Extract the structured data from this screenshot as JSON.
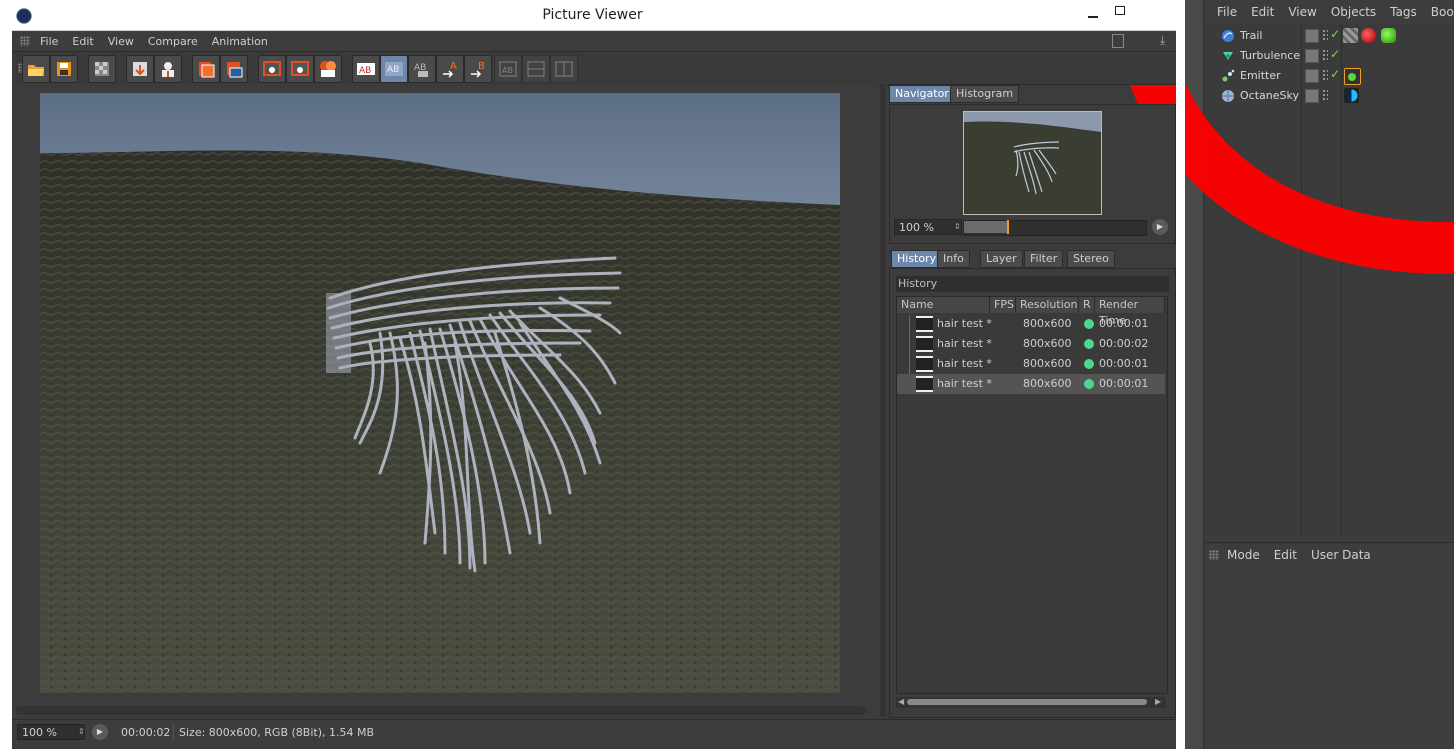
{
  "window": {
    "title": "Picture Viewer",
    "menu": [
      "File",
      "Edit",
      "View",
      "Compare",
      "Animation"
    ]
  },
  "toolbar": {
    "icons": [
      "open-icon",
      "save-icon",
      "transparency-icon",
      "render-queue-icon",
      "render-user-icon",
      "render-region-icon",
      "render-view-icon",
      "view-single-icon",
      "view-region-icon",
      "view-all-icon",
      "ab-compare-icon",
      "ab-split-icon",
      "ab-toggle-icon",
      "set-a-icon",
      "set-b-icon",
      "layout-1-icon",
      "layout-2-icon",
      "layout-3-icon"
    ]
  },
  "navigator": {
    "tabs": [
      "Navigator",
      "Histogram"
    ],
    "active_tab": "Navigator",
    "zoom": "100 %",
    "zoom_fraction": 0.24
  },
  "history_panel": {
    "tabs": [
      "History",
      "Info",
      "Layer",
      "Filter",
      "Stereo"
    ],
    "active_tab": "History",
    "header": "History",
    "columns": [
      "Name",
      "FPS",
      "Resolution",
      "R",
      "Render Time"
    ],
    "rows": [
      {
        "name": "hair test *",
        "fps": "",
        "resolution": "800x600",
        "status_color": "#4cd88c",
        "render_time": "00:00:01",
        "selected": false
      },
      {
        "name": "hair test *",
        "fps": "",
        "resolution": "800x600",
        "status_color": "#4cd88c",
        "render_time": "00:00:02",
        "selected": false
      },
      {
        "name": "hair test *",
        "fps": "",
        "resolution": "800x600",
        "status_color": "#4cd88c",
        "render_time": "00:00:01",
        "selected": false
      },
      {
        "name": "hair test *",
        "fps": "",
        "resolution": "800x600",
        "status_color": "#4cd88c",
        "render_time": "00:00:01",
        "selected": true
      }
    ]
  },
  "status_bar": {
    "zoom": "100 %",
    "time": "00:00:02",
    "info": "Size: 800x600, RGB (8Bit), 1.54 MB"
  },
  "object_manager": {
    "menu": [
      "File",
      "Edit",
      "View",
      "Objects",
      "Tags",
      "Book"
    ],
    "objects": [
      {
        "name": "Trail",
        "icon": "trail-icon"
      },
      {
        "name": "Turbulence",
        "icon": "turbulence-icon"
      },
      {
        "name": "Emitter",
        "icon": "emitter-icon"
      },
      {
        "name": "OctaneSky",
        "icon": "sky-icon"
      }
    ]
  },
  "attribute_manager": {
    "menu": [
      "Mode",
      "Edit",
      "User Data"
    ]
  },
  "colors": {
    "accent_tab": "#6d87ab",
    "status_ok": "#4cd88c",
    "annotation_red": "#ff0000",
    "slider_knob": "#f0a020"
  }
}
